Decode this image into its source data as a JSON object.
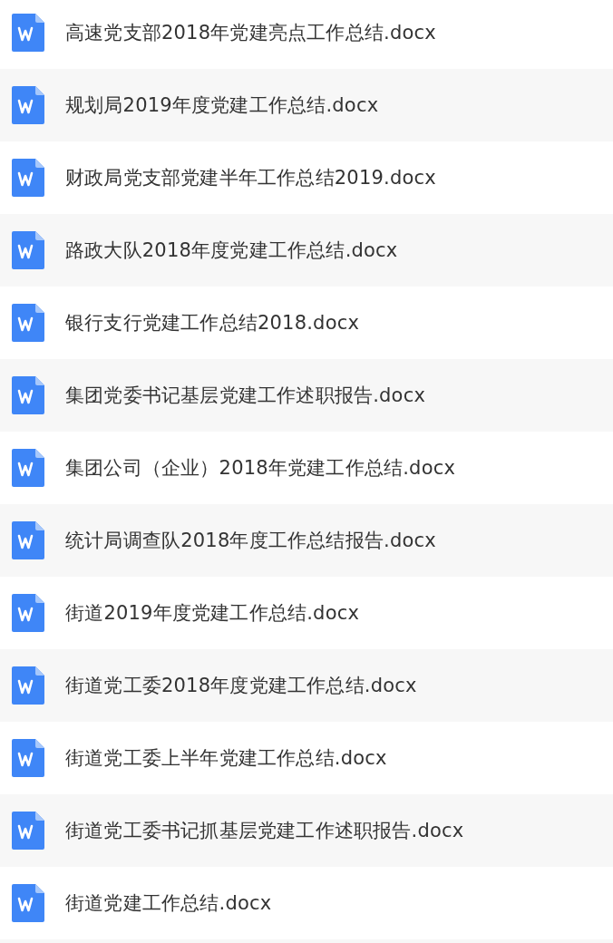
{
  "files": [
    {
      "name": "高速党支部2018年党建亮点工作总结.docx"
    },
    {
      "name": "规划局2019年度党建工作总结.docx"
    },
    {
      "name": "财政局党支部党建半年工作总结2019.docx"
    },
    {
      "name": "路政大队2018年度党建工作总结.docx"
    },
    {
      "name": "银行支行党建工作总结2018.docx"
    },
    {
      "name": "集团党委书记基层党建工作述职报告.docx"
    },
    {
      "name": "集团公司（企业）2018年党建工作总结.docx"
    },
    {
      "name": "统计局调查队2018年度工作总结报告.docx"
    },
    {
      "name": "街道2019年度党建工作总结.docx"
    },
    {
      "name": "街道党工委2018年度党建工作总结.docx"
    },
    {
      "name": "街道党工委上半年党建工作总结.docx"
    },
    {
      "name": "街道党工委书记抓基层党建工作述职报告.docx"
    },
    {
      "name": "街道党建工作总结.docx"
    }
  ]
}
